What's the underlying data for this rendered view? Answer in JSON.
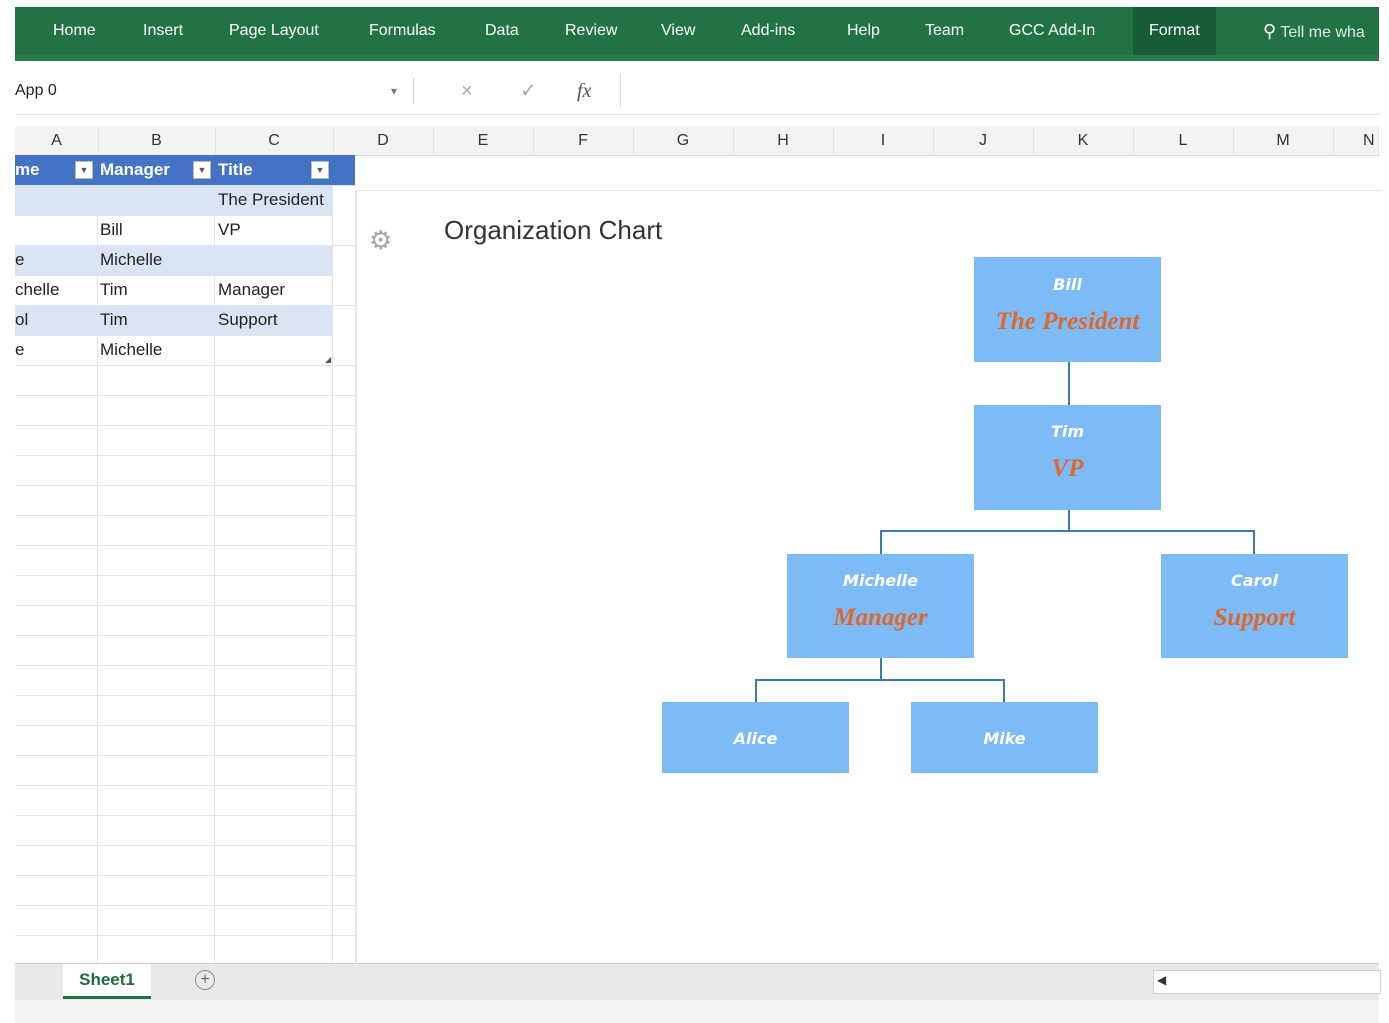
{
  "ribbon": {
    "tabs": [
      "Home",
      "Insert",
      "Page Layout",
      "Formulas",
      "Data",
      "Review",
      "View",
      "Add-ins",
      "Help",
      "Team",
      "GCC Add-In",
      "Format"
    ],
    "tell_me": "Tell me wha"
  },
  "formula_bar": {
    "name_box": "App 0",
    "cancel": "×",
    "enter": "✓",
    "fx": "fx"
  },
  "columns": [
    "A",
    "B",
    "C",
    "D",
    "E",
    "F",
    "G",
    "H",
    "I",
    "J",
    "K",
    "L",
    "M",
    "N"
  ],
  "table": {
    "headers": [
      "me",
      "Manager",
      "Title"
    ],
    "rows": [
      {
        "a": "",
        "b": "",
        "c": "The President"
      },
      {
        "a": "",
        "b": "Bill",
        "c": "VP"
      },
      {
        "a": "e",
        "b": "Michelle",
        "c": ""
      },
      {
        "a": "chelle",
        "b": "Tim",
        "c": "Manager"
      },
      {
        "a": "ol",
        "b": "Tim",
        "c": "Support"
      },
      {
        "a": "e",
        "b": "Michelle",
        "c": ""
      }
    ]
  },
  "org_chart": {
    "title": "Organization Chart",
    "nodes": [
      {
        "name": "Bill",
        "title": "The President"
      },
      {
        "name": "Tim",
        "title": "VP"
      },
      {
        "name": "Michelle",
        "title": "Manager"
      },
      {
        "name": "Carol",
        "title": "Support"
      },
      {
        "name": "Alice",
        "title": ""
      },
      {
        "name": "Mike",
        "title": ""
      }
    ]
  },
  "sheets": {
    "active": "Sheet1",
    "add": "+"
  },
  "colors": {
    "ribbon": "#217346",
    "table_header": "#4472c4",
    "band": "#dbe4f3",
    "node_fill": "#7cbbf5",
    "node_title": "#e0672c"
  }
}
